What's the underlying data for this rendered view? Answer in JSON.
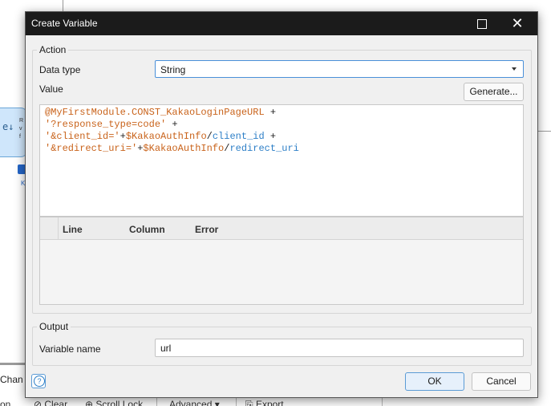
{
  "background": {
    "node_icon": "e-icon",
    "node_text": [
      "R",
      "v",
      "f"
    ],
    "k_label": "K",
    "changes_tab": "Chan",
    "toolbar": {
      "left_fragment": "on",
      "clear": "Clear",
      "scroll_lock": "Scroll Lock",
      "advanced": "Advanced",
      "export": "Export"
    }
  },
  "dialog": {
    "title": "Create Variable",
    "maximize_icon": "maximize-icon",
    "close_symbol": "✕",
    "action": {
      "legend": "Action",
      "data_type_label": "Data type",
      "data_type_value": "String",
      "value_label": "Value",
      "generate_label": "Generate...",
      "expression": {
        "line1_a": "@MyFirstModule.CONST_KakaoLoginPageURL",
        "line1_b": " +",
        "line2_a": "'?response_type=code'",
        "line2_b": " +",
        "line3_a": "'&client_id='",
        "line3_b": "+",
        "line3_c": "$KakaoAuthInfo",
        "line3_d": "/",
        "line3_e": "client_id",
        "line3_f": " +",
        "line4_a": "'&redirect_uri='",
        "line4_b": "+",
        "line4_c": "$KakaoAuthInfo",
        "line4_d": "/",
        "line4_e": "redirect_uri"
      },
      "errors": {
        "columns": [
          "Line",
          "Column",
          "Error"
        ],
        "rows": []
      }
    },
    "output": {
      "legend": "Output",
      "variable_name_label": "Variable name",
      "variable_name_value": "url"
    },
    "footer": {
      "help_symbol": "?",
      "ok_label": "OK",
      "cancel_label": "Cancel"
    }
  }
}
